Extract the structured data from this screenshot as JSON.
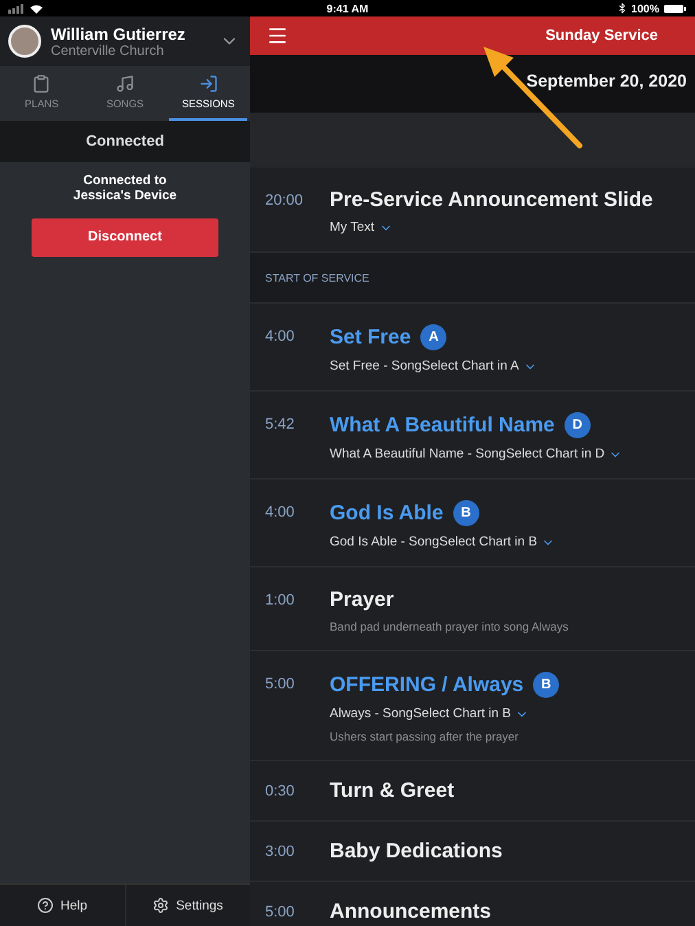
{
  "status_bar": {
    "time": "9:41 AM",
    "battery": "100%"
  },
  "sidebar": {
    "user": {
      "name": "William Gutierrez",
      "organization": "Centerville Church"
    },
    "tabs": [
      {
        "label": "PLANS",
        "selected": false
      },
      {
        "label": "SONGS",
        "selected": false
      },
      {
        "label": "SESSIONS",
        "selected": true
      }
    ],
    "section_title": "Connected",
    "message": [
      "Connected to",
      "Jessica's Device"
    ],
    "disconnect_button": "Disconnect",
    "footer": [
      {
        "label": "Help"
      },
      {
        "label": "Settings"
      }
    ]
  },
  "header": {
    "title": "Sunday Service",
    "date": "September 20, 2020"
  },
  "plan_items": [
    {
      "kind": "item",
      "time": "20:00",
      "title": "Pre-Service Announcement Slide",
      "arrangement": "My Text"
    },
    {
      "kind": "header",
      "title": "START OF SERVICE"
    },
    {
      "kind": "song",
      "time": "4:00",
      "title": "Set Free",
      "key": "A",
      "arrangement": "Set Free - SongSelect Chart in A"
    },
    {
      "kind": "song",
      "time": "5:42",
      "title": "What A Beautiful Name",
      "key": "D",
      "arrangement": "What A Beautiful Name - SongSelect Chart in D"
    },
    {
      "kind": "song",
      "time": "4:00",
      "title": "God Is Able",
      "key": "B",
      "arrangement": "God Is Able - SongSelect Chart in B"
    },
    {
      "kind": "item",
      "time": "1:00",
      "title": "Prayer",
      "note": "Band pad underneath prayer into song Always"
    },
    {
      "kind": "song",
      "time": "5:00",
      "title": "OFFERING / Always",
      "key": "B",
      "arrangement": "Always - SongSelect Chart in B",
      "note": "Ushers start passing after the prayer"
    },
    {
      "kind": "item",
      "time": "0:30",
      "title": "Turn & Greet"
    },
    {
      "kind": "item",
      "time": "3:00",
      "title": "Baby Dedications"
    },
    {
      "kind": "item",
      "time": "5:00",
      "title": "Announcements"
    }
  ]
}
